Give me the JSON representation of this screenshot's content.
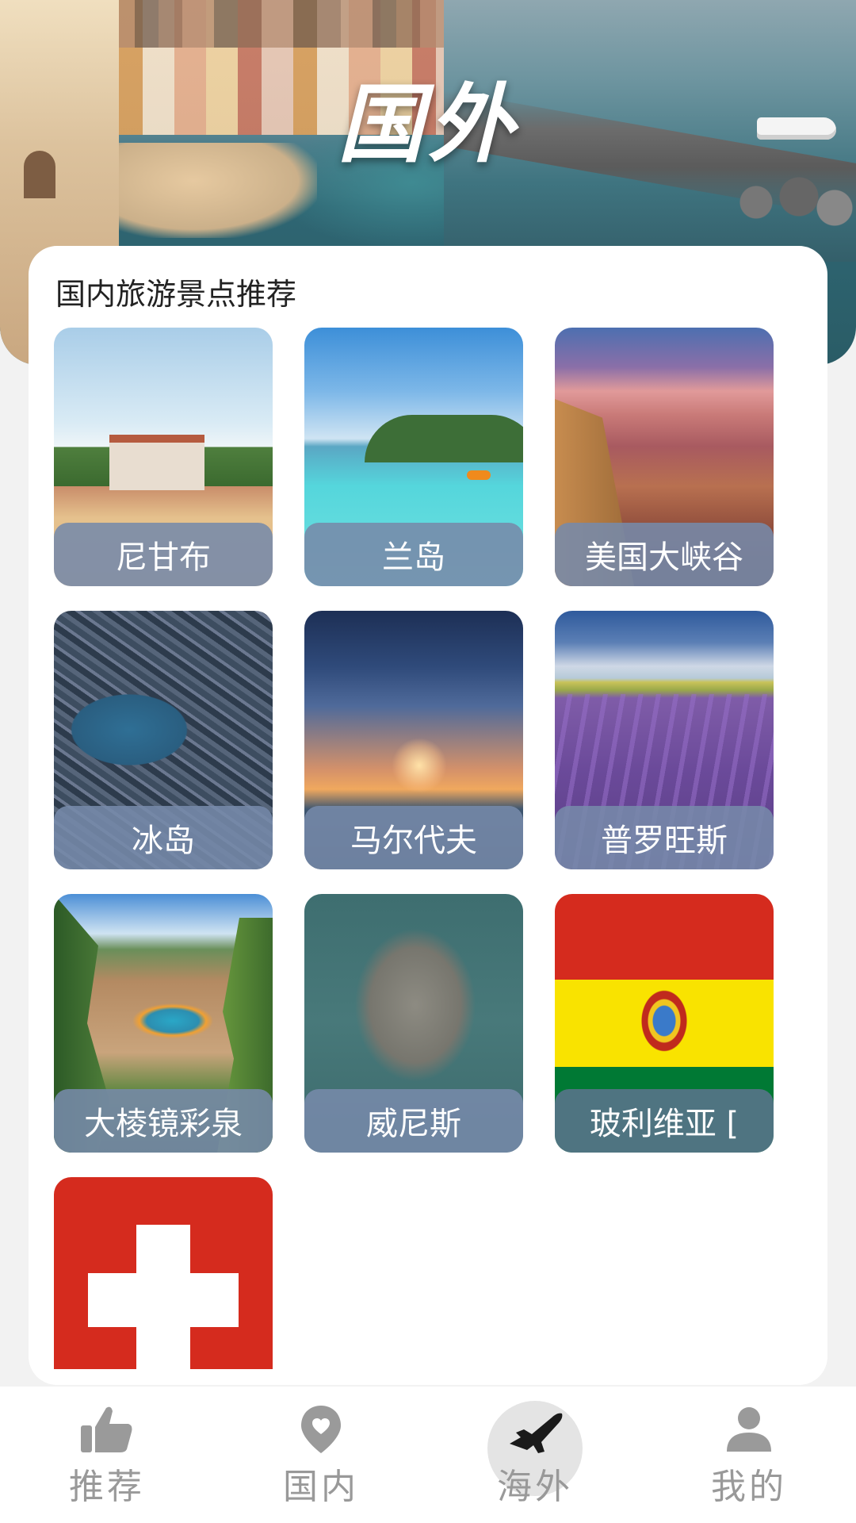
{
  "hero": {
    "title": "国外"
  },
  "section": {
    "title": "国内旅游景点推荐"
  },
  "destinations": [
    {
      "name": "尼甘布"
    },
    {
      "name": "兰岛"
    },
    {
      "name": "美国大峡谷"
    },
    {
      "name": "冰岛"
    },
    {
      "name": "马尔代夫"
    },
    {
      "name": "普罗旺斯"
    },
    {
      "name": "大棱镜彩泉"
    },
    {
      "name": "威尼斯"
    },
    {
      "name": "玻利维亚 ["
    },
    {
      "name": ""
    }
  ],
  "nav": {
    "items": [
      {
        "label": "推荐",
        "icon": "thumbs-up-icon"
      },
      {
        "label": "国内",
        "icon": "location-pin-icon"
      },
      {
        "label": "海外",
        "icon": "airplane-icon",
        "active": true
      },
      {
        "label": "我的",
        "icon": "user-icon"
      }
    ]
  },
  "colors": {
    "caption_bg": "#768aaa",
    "nav_text": "#999999",
    "nav_active_halo": "#e4e4e4",
    "card_bg": "#ffffff"
  }
}
